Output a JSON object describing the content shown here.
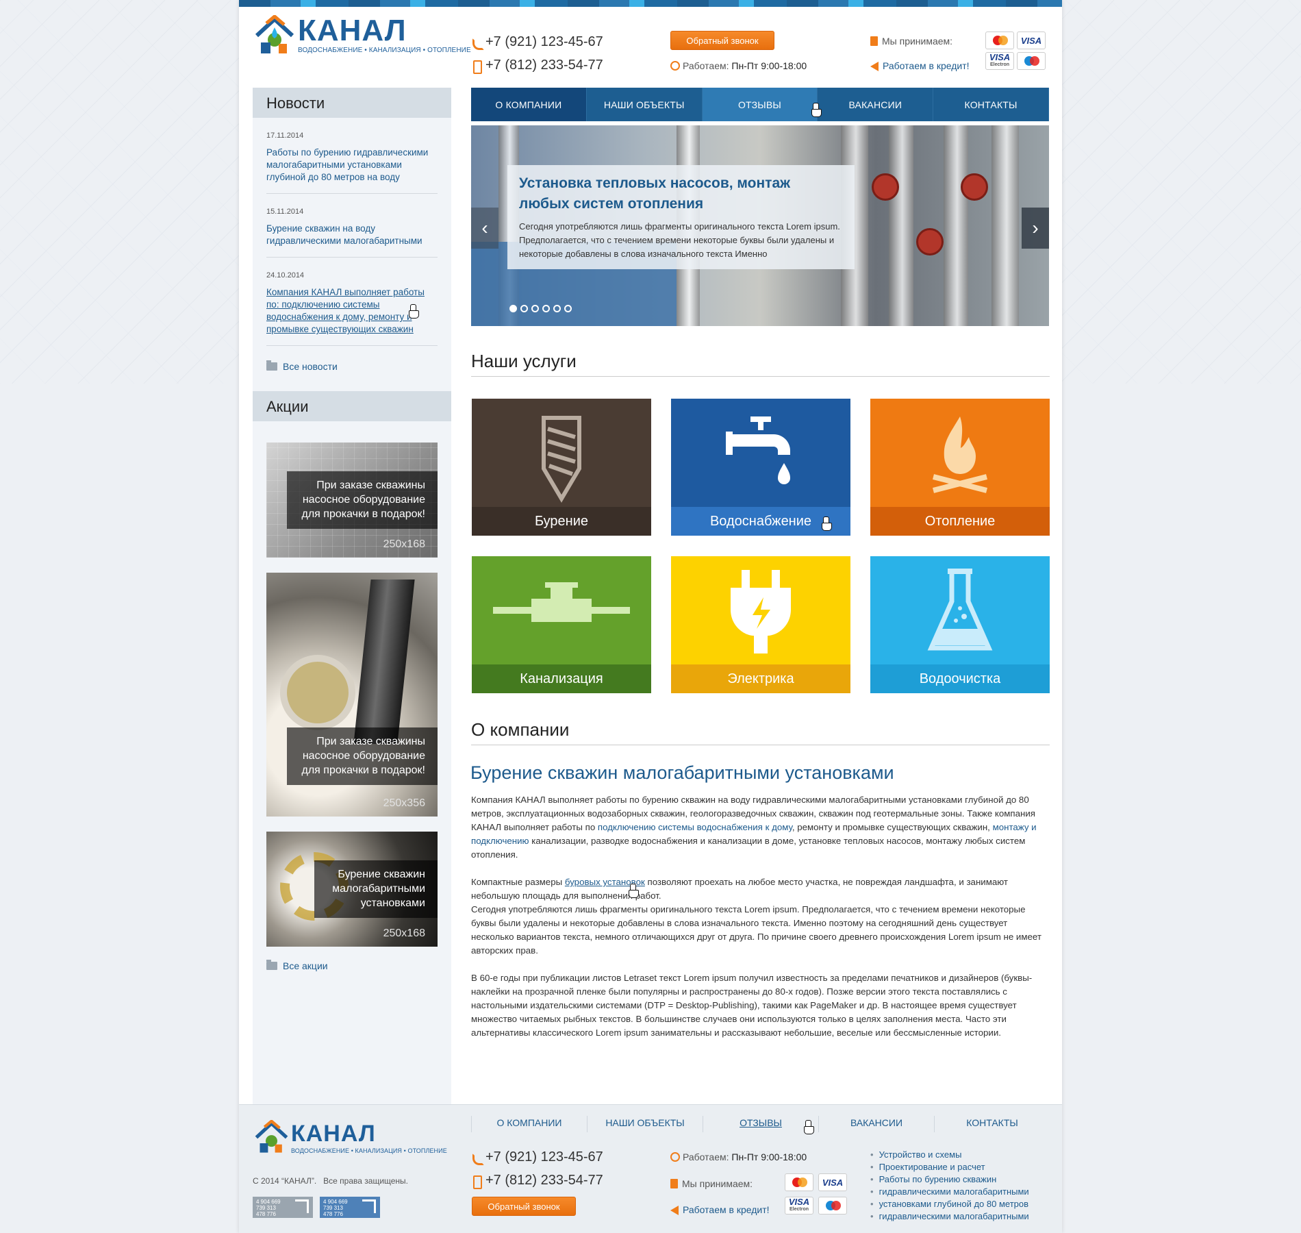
{
  "brand": {
    "name": "КАНАЛ",
    "tagline": "ВОДОСНАБЖЕНИЕ • КАНАЛИЗАЦИЯ • ОТОПЛЕНИЕ",
    "colors": {
      "blue": "#1d5e91",
      "orange": "#f07d1a"
    }
  },
  "header": {
    "phone1": "+7 (921) 123-45-67",
    "phone2": "+7 (812) 233-54-77",
    "callback_label": "Обратный звонок",
    "hours_label": "Работаем:",
    "hours_value": "Пн-Пт 9:00-18:00",
    "accept_label": "Мы принимаем:",
    "credit_label": "Работаем в кредит!",
    "cards": {
      "mastercard": "MasterCard",
      "visa": "VISA",
      "visa_electron": "VISA",
      "electron": "Electron",
      "maestro": "Maestro"
    }
  },
  "nav": {
    "items": [
      {
        "label": "О КОМПАНИИ"
      },
      {
        "label": "НАШИ ОБЪЕКТЫ"
      },
      {
        "label": "ОТЗЫВЫ"
      },
      {
        "label": "ВАКАНСИИ"
      },
      {
        "label": "КОНТАКТЫ"
      }
    ]
  },
  "slider": {
    "title": "Установка тепловых насосов, монтаж любых систем отопления",
    "text": "Сегодня употребляются лишь фрагменты оригинального текста Lorem ipsum. Предполагается, что с течением времени некоторые буквы были удалены и некоторые добавлены в слова изначального текста Именно",
    "dots_total": 6,
    "active_dot": 1
  },
  "sidebar": {
    "news_title": "Новости",
    "news": [
      {
        "date": "17.11.2014",
        "text": "Работы по бурению гидравлическими малогабаритными установками глубиной до 80 метров на воду"
      },
      {
        "date": "15.11.2014",
        "text": "Бурение скважин на воду гидравлическими малогабаритными"
      },
      {
        "date": "24.10.2014",
        "text": "Компания КАНАЛ выполняет работы по: подключению системы водоснабжения к дому, ремонту и промывке существующих скважин"
      }
    ],
    "all_news": "Все новости",
    "promo_title": "Акции",
    "promos": [
      {
        "caption": "При заказе скважины насосное оборудование для прокачки в подарок!",
        "size": "250x168"
      },
      {
        "caption": "При заказе скважины насосное оборудование для прокачки в подарок!",
        "size": "250x356"
      },
      {
        "caption": "Бурение скважин малогабаритными установками",
        "size": "250x168"
      }
    ],
    "all_promos": "Все акции"
  },
  "services": {
    "title": "Наши услуги",
    "items": [
      {
        "label": "Бурение",
        "icon": "drill-icon",
        "bg": "#4a3c33",
        "bar": "#3a2f28"
      },
      {
        "label": "Водоснабжение",
        "icon": "faucet-icon",
        "bg": "#1e5aa0",
        "bar": "#2f74c2"
      },
      {
        "label": "Отопление",
        "icon": "fire-icon",
        "bg": "#ef7a12",
        "bar": "#d35f0a"
      },
      {
        "label": "Канализация",
        "icon": "pipe-icon",
        "bg": "#64a12b",
        "bar": "#447a1f"
      },
      {
        "label": "Электрика",
        "icon": "plug-icon",
        "bg": "#fdd200",
        "bar": "#e9a60a"
      },
      {
        "label": "Водоочистка",
        "icon": "flask-icon",
        "bg": "#2ab2e8",
        "bar": "#1e9ed6"
      }
    ]
  },
  "about": {
    "title": "О компании",
    "heading": "Бурение скважин малогабаритными установками",
    "p1a": "Компания КАНАЛ выполняет работы по бурению скважин на воду гидравлическими малогабаритными установками глубиной до 80 метров, эксплуатационных водозаборных скважин, геологоразведочных скважин, скважин под геотермальные зоны. Также компания КАНАЛ выполняет работы по ",
    "p1_link1": "подключению системы водоснабжения к дому",
    "p1b": ", ремонту и промывке существующих скважин, ",
    "p1_link2": "монтажу и подключению",
    "p1c": " канализации, разводке водоснабжения и канализации в доме, установке тепловых насосов, монтажу любых систем отопления.",
    "p2a": "Компактные размеры ",
    "p2_link": "буровых установок",
    "p2b": " позволяют проехать на любое место участка, не повреждая ландшафта, и занимают небольшую площадь для выполнения работ.",
    "p2c": "Сегодня употребляются лишь фрагменты оригинального текста Lorem ipsum. Предполагается, что с течением времени некоторые буквы были удалены и некоторые добавлены в слова изначального текста. Именно поэтому на сегодняшний день существует несколько вариантов текста, немного отличающихся друг от друга. По причине своего древнего происхождения Lorem ipsum не имеет авторских прав.",
    "p3": "В 60-е годы при публикации листов Letraset текст Lorem ipsum получил известность за пределами печатников и дизайнеров (буквы-наклейки на прозрачной пленке были популярны и распространены до 80-х годов). Позже версии этого текста поставлялись с настольными издательскими системами (DTP = Desktop-Publishing), такими как PageMaker и др. В настоящее время существует множество читаемых рыбных текстов. В большинстве случаев они используются только в целях заполнения места. Часто эти альтернативы классического Lorem ipsum занимательны и рассказывают небольшие, веселые или бессмысленные истории."
  },
  "footer": {
    "nav": [
      "О КОМПАНИИ",
      "НАШИ ОБЪЕКТЫ",
      "ОТЗЫВЫ",
      "ВАКАНСИИ",
      "КОНТАКТЫ"
    ],
    "copyright": "С 2014 “КАНАЛ”.   Все права защищены.",
    "counter1": "4 904 669\n739 313\n478 776",
    "counter2": "4 904 669\n739 313\n478 776",
    "links": [
      "Устройство и схемы",
      "Проектирование и расчет",
      "Работы по  бурению  скважин",
      "гидравлическими малогабаритными",
      "установками глубиной до 80 метров",
      "гидравлическими малогабаритными"
    ]
  }
}
